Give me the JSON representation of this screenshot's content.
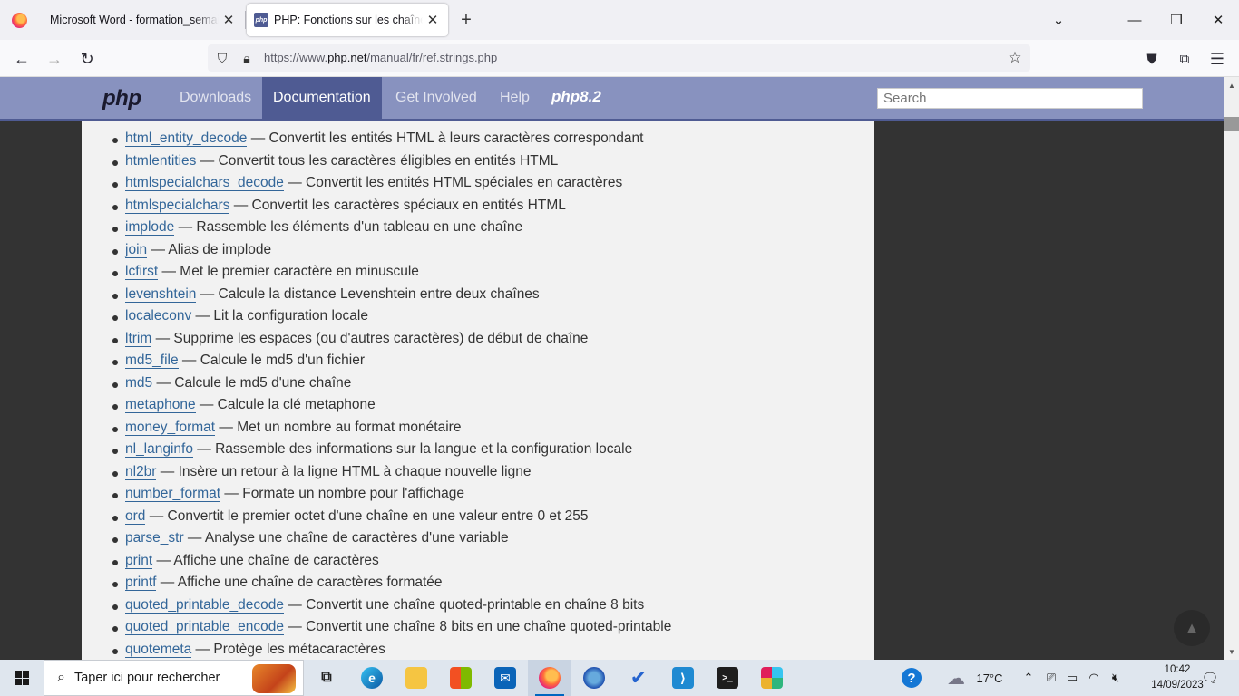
{
  "browser": {
    "tabs": [
      {
        "title": "Microsoft Word - formation_semaine",
        "active": false
      },
      {
        "title": "PHP: Fonctions sur les chaînes de caractères",
        "active": true
      }
    ],
    "url_prefix": "https://www.",
    "url_domain": "php.net",
    "url_path": "/manual/fr/ref.strings.php"
  },
  "php_header": {
    "logo": "php",
    "nav": [
      "Downloads",
      "Documentation",
      "Get Involved",
      "Help"
    ],
    "active_nav": "Documentation",
    "version_logo": "php8.2",
    "search_placeholder": "Search"
  },
  "functions": [
    {
      "name": "html_entity_decode",
      "desc": " — Convertit les entités HTML à leurs caractères correspondant"
    },
    {
      "name": "htmlentities",
      "desc": " — Convertit tous les caractères éligibles en entités HTML"
    },
    {
      "name": "htmlspecialchars_decode",
      "desc": " — Convertit les entités HTML spéciales en caractères"
    },
    {
      "name": "htmlspecialchars",
      "desc": " — Convertit les caractères spéciaux en entités HTML"
    },
    {
      "name": "implode",
      "desc": " — Rassemble les éléments d'un tableau en une chaîne"
    },
    {
      "name": "join",
      "desc": " — Alias de implode"
    },
    {
      "name": "lcfirst",
      "desc": " — Met le premier caractère en minuscule"
    },
    {
      "name": "levenshtein",
      "desc": " — Calcule la distance Levenshtein entre deux chaînes"
    },
    {
      "name": "localeconv",
      "desc": " — Lit la configuration locale"
    },
    {
      "name": "ltrim",
      "desc": " — Supprime les espaces (ou d'autres caractères) de début de chaîne"
    },
    {
      "name": "md5_file",
      "desc": " — Calcule le md5 d'un fichier"
    },
    {
      "name": "md5",
      "desc": " — Calcule le md5 d'une chaîne"
    },
    {
      "name": "metaphone",
      "desc": " — Calcule la clé metaphone"
    },
    {
      "name": "money_format",
      "desc": " — Met un nombre au format monétaire"
    },
    {
      "name": "nl_langinfo",
      "desc": " — Rassemble des informations sur la langue et la configuration locale"
    },
    {
      "name": "nl2br",
      "desc": " — Insère un retour à la ligne HTML à chaque nouvelle ligne"
    },
    {
      "name": "number_format",
      "desc": " — Formate un nombre pour l'affichage"
    },
    {
      "name": "ord",
      "desc": " — Convertit le premier octet d'une chaîne en une valeur entre 0 et 255"
    },
    {
      "name": "parse_str",
      "desc": " — Analyse une chaîne de caractères d'une variable"
    },
    {
      "name": "print",
      "desc": " — Affiche une chaîne de caractères"
    },
    {
      "name": "printf",
      "desc": " — Affiche une chaîne de caractères formatée"
    },
    {
      "name": "quoted_printable_decode",
      "desc": " — Convertit une chaîne quoted-printable en chaîne 8 bits"
    },
    {
      "name": "quoted_printable_encode",
      "desc": " — Convertit une chaîne 8 bits en une chaîne quoted-printable"
    },
    {
      "name": "quotemeta",
      "desc": " — Protège les métacaractères"
    }
  ],
  "taskbar": {
    "search_text": "Taper ici pour rechercher",
    "weather": "17°C",
    "time": "10:42",
    "date": "14/09/2023"
  }
}
